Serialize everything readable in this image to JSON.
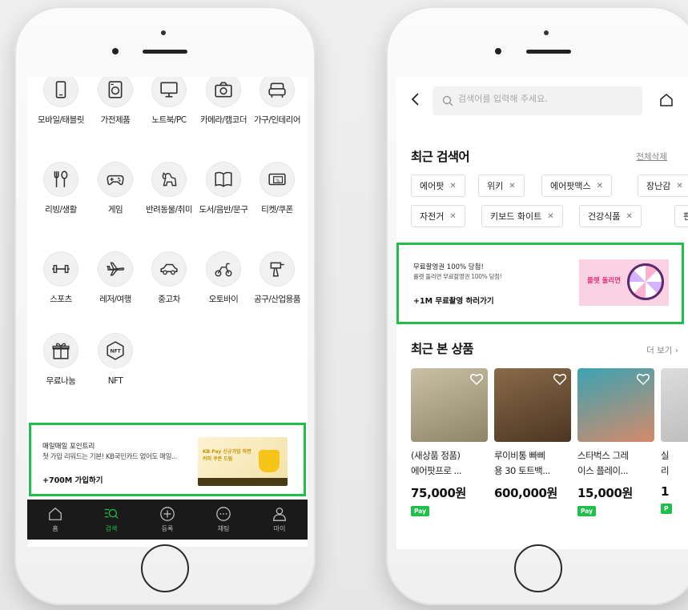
{
  "colors": {
    "accent": "#1fbf4a",
    "tabbar_bg": "#1a1a1a",
    "text": "#222222"
  },
  "left_screen": {
    "categories": [
      {
        "icon": "mobile-icon",
        "label": "모바일/태블릿"
      },
      {
        "icon": "washer-icon",
        "label": "가전제품"
      },
      {
        "icon": "monitor-icon",
        "label": "노트북/PC"
      },
      {
        "icon": "camera-icon",
        "label": "카메라/캠코더"
      },
      {
        "icon": "sofa-icon",
        "label": "가구/인테리어"
      },
      {
        "icon": "utensils-icon",
        "label": "리빙/생활"
      },
      {
        "icon": "gamepad-icon",
        "label": "게임"
      },
      {
        "icon": "dog-icon",
        "label": "반려동물/취미"
      },
      {
        "icon": "book-icon",
        "label": "도서/음반/문구"
      },
      {
        "icon": "ticket-icon",
        "label": "티켓/쿠폰"
      },
      {
        "icon": "dumbbell-icon",
        "label": "스포츠"
      },
      {
        "icon": "airplane-icon",
        "label": "레저/여행"
      },
      {
        "icon": "car-icon",
        "label": "중고차"
      },
      {
        "icon": "motorbike-icon",
        "label": "오토바이"
      },
      {
        "icon": "drill-icon",
        "label": "공구/산업용품"
      },
      {
        "icon": "gift-icon",
        "label": "무료나눔"
      },
      {
        "icon": "nft-icon",
        "label": "NFT"
      }
    ],
    "banner": {
      "title": "매일매일 포인트리",
      "desc": "첫 가입 리워드는 기본! KB국민카드 없어도 매일...",
      "cta": "+700M 가입하기",
      "image_text": "KB Pay 신규가입 하면 커피 쿠폰 드림"
    },
    "tabs": [
      {
        "icon": "home-icon",
        "label": "홈"
      },
      {
        "icon": "search-list-icon",
        "label": "검색",
        "active": true
      },
      {
        "icon": "plus-circle-icon",
        "label": "등록"
      },
      {
        "icon": "chat-icon",
        "label": "채팅"
      },
      {
        "icon": "person-icon",
        "label": "마이"
      }
    ]
  },
  "right_screen": {
    "search": {
      "placeholder": "검색어를 입력해 주세요."
    },
    "recent": {
      "title": "최근 검색어",
      "clear_all": "전체삭제",
      "row1": [
        "에어팟",
        "위키",
        "에어팟맥스",
        "장난감"
      ],
      "row2": [
        "자전거",
        "키보드 화이트",
        "건강식품",
        "펀"
      ]
    },
    "banner": {
      "title": "무료촬영권 100% 당첨!",
      "desc": "룰렛 돌리면 무료촬영권 100% 당첨!",
      "cta": "+1M 무료촬영 하러가기",
      "image_text": "룰렛 돌리면"
    },
    "recent_items": {
      "title": "최근 본 상품",
      "more": "더 보기",
      "products": [
        {
          "name1": "(새상품 정품)",
          "name2": "에어팟프로 ...",
          "price": "75,000원",
          "pay": "Pay"
        },
        {
          "name1": "루이비통 빠삐",
          "name2": "용 30 토트백...",
          "price": "600,000원",
          "pay": ""
        },
        {
          "name1": "스타벅스 그레",
          "name2": "이스 플레이...",
          "price": "15,000원",
          "pay": "Pay"
        },
        {
          "name1": "실",
          "name2": "리",
          "price": "1",
          "pay": "P"
        }
      ]
    }
  }
}
